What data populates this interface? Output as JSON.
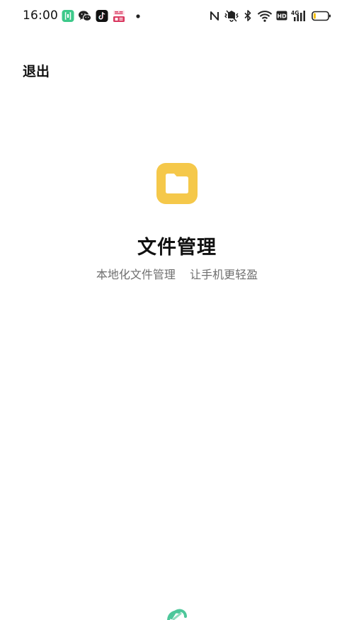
{
  "status_bar": {
    "time": "16:00",
    "network_label": "4G",
    "hd_label": "HD",
    "notification_icons": [
      "bracket-app-icon",
      "wechat-icon",
      "tiktok-icon",
      "news-app-icon",
      "more-dot-icon"
    ],
    "system_icons": [
      "nfc-icon",
      "mute-vibrate-icon",
      "bluetooth-icon",
      "wifi-icon",
      "hd-icon",
      "signal-4g-icon",
      "battery-icon"
    ],
    "battery_level": 0.15,
    "colors": {
      "bracket_app": "#3dc98a",
      "tiktok": "#111111",
      "news_app": "#d9365e"
    }
  },
  "header": {
    "exit_label": "退出"
  },
  "app": {
    "title": "文件管理",
    "tagline": "本地化文件管理    让手机更轻盈",
    "icon": "folder-icon",
    "icon_color": "#f5c84a"
  },
  "footer": {
    "icon": "brand-logo-icon",
    "icon_color": "#4dc79a"
  }
}
